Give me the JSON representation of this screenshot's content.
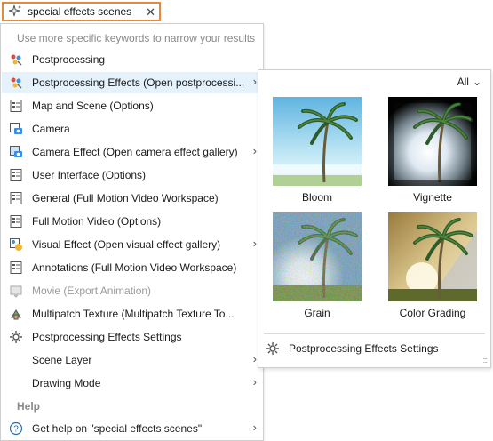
{
  "search": {
    "value": "special effects scenes",
    "clear_icon": "close-icon",
    "clear_glyph": "✕"
  },
  "menu": {
    "hint": "Use more specific keywords to narrow your results",
    "items": [
      {
        "label": "Postprocessing",
        "icon": "postprocessing-icon",
        "arrow": false
      },
      {
        "label": "Postprocessing Effects (Open postprocessi...",
        "icon": "postprocessing-icon",
        "arrow": true
      },
      {
        "label": "Map and Scene (Options)",
        "icon": "options-icon",
        "arrow": false
      },
      {
        "label": "Camera",
        "icon": "camera-options-icon",
        "arrow": false
      },
      {
        "label": "Camera Effect (Open camera effect gallery)",
        "icon": "camera-effect-icon",
        "arrow": true
      },
      {
        "label": "User Interface (Options)",
        "icon": "options-icon",
        "arrow": false
      },
      {
        "label": "General (Full Motion Video Workspace)",
        "icon": "options-icon",
        "arrow": false
      },
      {
        "label": "Full Motion Video (Options)",
        "icon": "options-icon",
        "arrow": false
      },
      {
        "label": "Visual Effect (Open visual effect gallery)",
        "icon": "visual-effect-icon",
        "arrow": true
      },
      {
        "label": "Annotations (Full Motion Video Workspace)",
        "icon": "options-icon",
        "arrow": false
      },
      {
        "label": "Movie (Export Animation)",
        "icon": "movie-export-icon",
        "arrow": false
      },
      {
        "label": "Multipatch Texture (Multipatch Texture To...",
        "icon": "multipatch-texture-icon",
        "arrow": false
      },
      {
        "label": "Postprocessing Effects Settings",
        "icon": "gear-icon",
        "arrow": false
      },
      {
        "label": "Scene Layer",
        "icon": "",
        "arrow": true
      },
      {
        "label": "Drawing Mode",
        "icon": "",
        "arrow": true
      }
    ],
    "help_heading": "Help",
    "help_item": {
      "label": "Get help on  \"special effects scenes\"",
      "icon": "help-icon"
    },
    "arrow_glyph": "›"
  },
  "gallery": {
    "filter": "All",
    "filter_chevron": "⌄",
    "effects": [
      "Bloom",
      "Vignette",
      "Grain",
      "Color Grading"
    ],
    "footer_label": "Postprocessing Effects Settings",
    "footer_icon": "gear-icon",
    "resize_grip": ":::"
  },
  "colors": {
    "search_border": "#e58a3a",
    "highlight": "#e5f1fb",
    "hint": "#8a8a8a"
  }
}
